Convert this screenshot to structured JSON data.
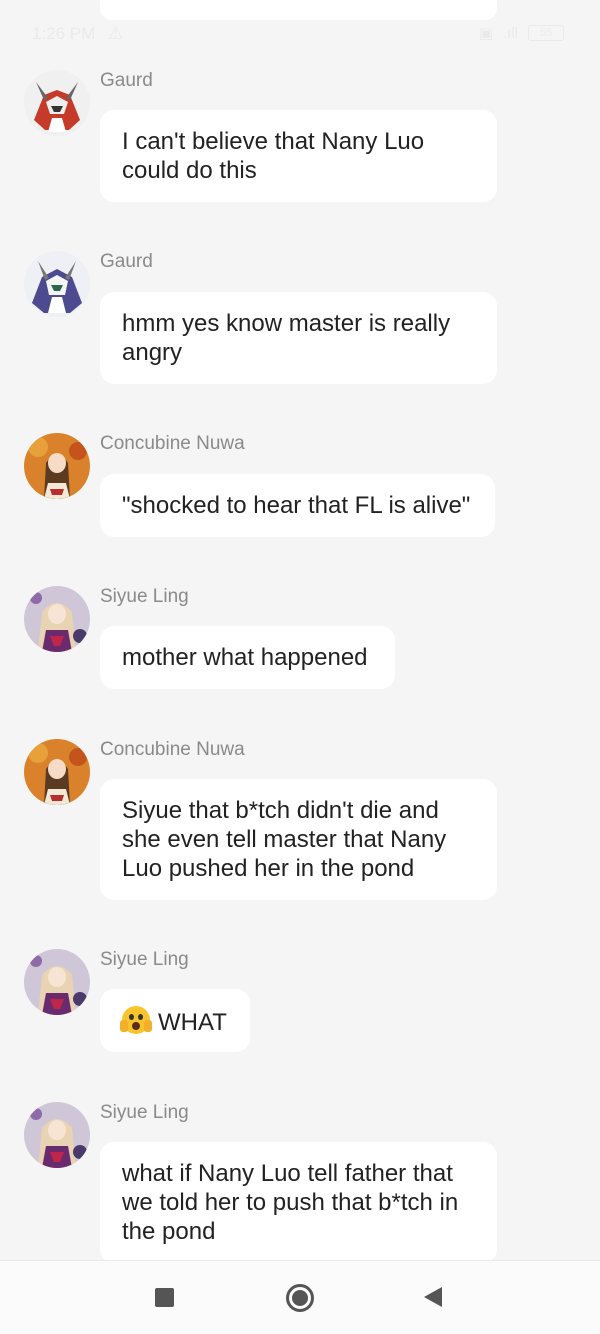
{
  "status_bar": {
    "time": "1:26 PM",
    "alert_icon": "warning-triangle-icon",
    "signal": ".ıll",
    "battery": "55"
  },
  "messages": [
    {
      "sender": "Gaurd",
      "avatar": "mecha-red",
      "lines": [
        "I can't believe that Nany Luo",
        "could do this"
      ]
    },
    {
      "sender": "Gaurd",
      "avatar": "mecha-purple",
      "lines": [
        "hmm yes know master is really",
        "angry"
      ]
    },
    {
      "sender": "Concubine Nuwa",
      "avatar": "anime-autumn",
      "lines": [
        "\"shocked to hear that FL is alive\""
      ]
    },
    {
      "sender": "Siyue Ling",
      "avatar": "anime-purple",
      "lines": [
        "mother what happened"
      ]
    },
    {
      "sender": "Concubine Nuwa",
      "avatar": "anime-autumn",
      "lines": [
        "Siyue that b*tch didn't die and",
        "she even tell master that Nany",
        "Luo pushed her in the pond"
      ]
    },
    {
      "sender": "Siyue Ling",
      "avatar": "anime-purple",
      "emoji": "face-screaming-in-fear",
      "lines": [
        "WHAT"
      ]
    },
    {
      "sender": "Siyue Ling",
      "avatar": "anime-purple",
      "lines": [
        "what if Nany Luo tell father that",
        "we told her to push that b*tch in",
        "the pond"
      ]
    }
  ],
  "nav": {
    "recents": "square-recents-icon",
    "home": "circle-home-icon",
    "back": "triangle-back-icon"
  },
  "colors": {
    "background": "#f5f5f5",
    "bubble": "#ffffff",
    "sender": "#8a8a8a",
    "text": "#222222"
  }
}
